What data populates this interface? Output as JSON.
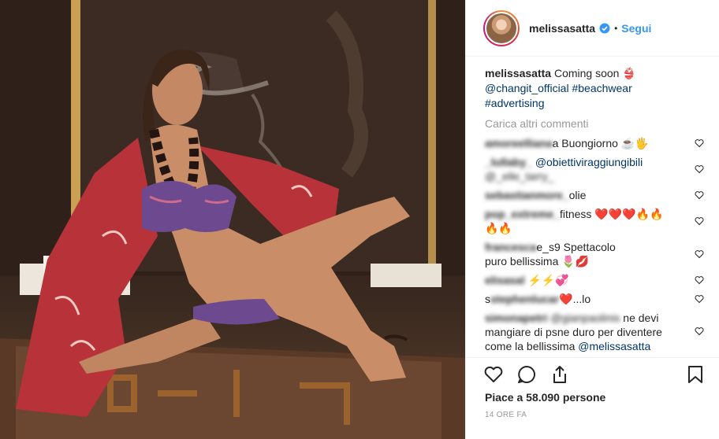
{
  "post": {
    "username": "melissasatta",
    "follow_label": "Segui",
    "dot": "•"
  },
  "caption": {
    "username": "melissasatta",
    "text": "Coming soon 👙",
    "mention": "@changit_official",
    "tag1": "#beachwear",
    "tag2": "#advertising"
  },
  "load_more": "Carica altri commenti",
  "comments": [
    {
      "user": "amoreelliana",
      "text": "a Buongiorno ☕️🖐"
    },
    {
      "user": "_lullaby_",
      "mention": "@obiettiviraggiungibili",
      "mention2": "@_elle_tarry_"
    },
    {
      "user": "sebastianmore_",
      "text": "olie"
    },
    {
      "user": "pop_extreme_",
      "text": "fitness ❤️❤️❤️🔥🔥",
      "text2": "🔥🔥"
    },
    {
      "user": "francesca",
      "text": "e_s9 Spettacolo",
      "text2": "puro bellissima 🌷💋"
    },
    {
      "user": "elisasal",
      "text": "⚡⚡💞"
    },
    {
      "user": "stephenlucar",
      "text": "s",
      "text3": "❤️...lo"
    },
    {
      "user": "simonapetri",
      "mention": "@gianpaolinis",
      "text": "ne devi",
      "text2": "mangiare di psne duro per diventere",
      "text3": "come la bellissima",
      "mention2": "@melissasatta"
    }
  ],
  "likes": "Piace a 58.090 persone",
  "time": "14 ORE FA",
  "colors": {
    "link": "#003569",
    "follow": "#3897f0",
    "muted": "#999999"
  }
}
